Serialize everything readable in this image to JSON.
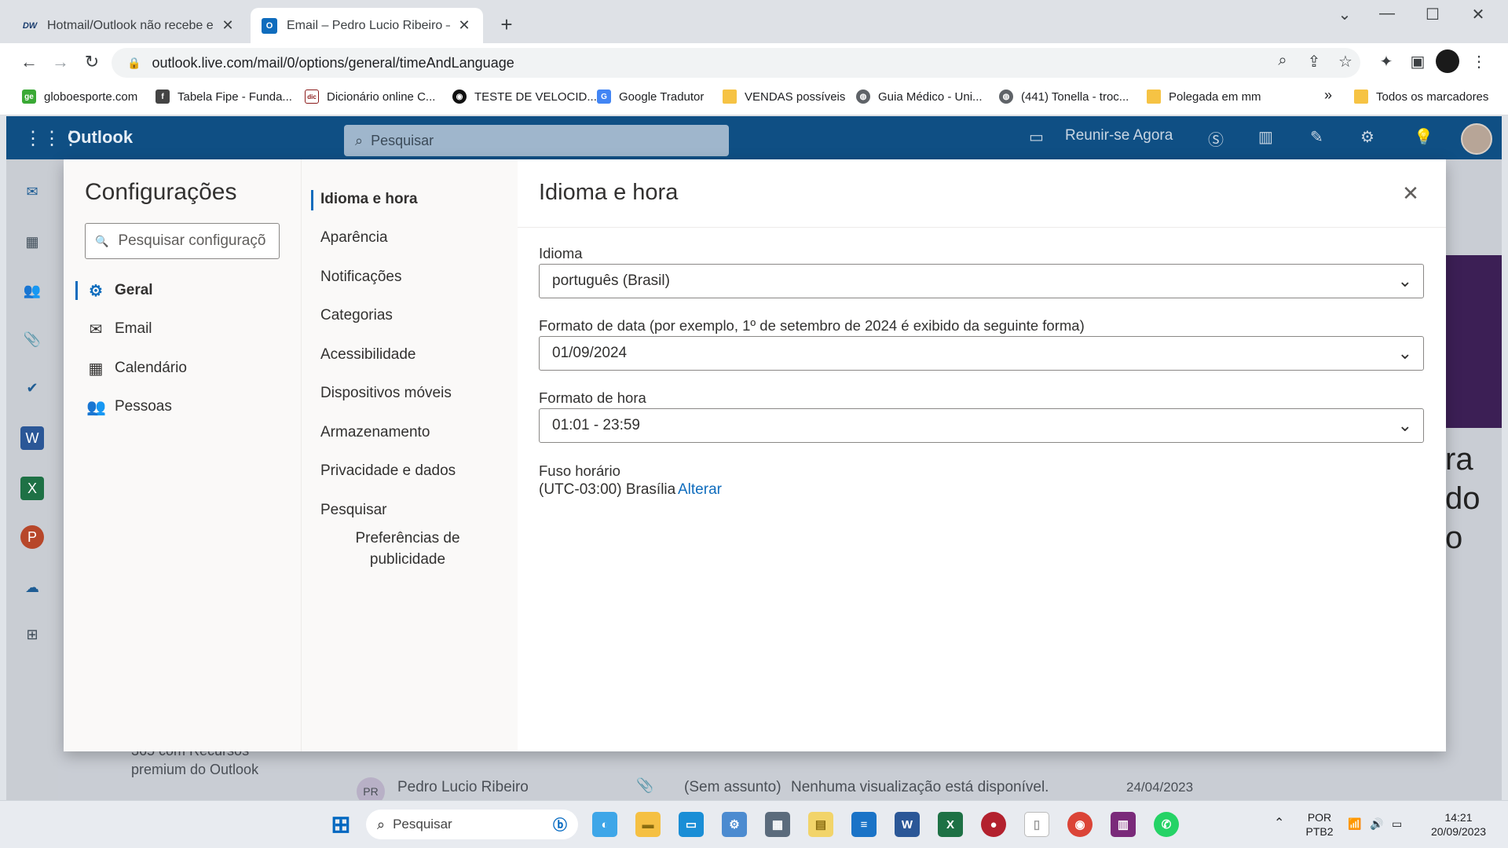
{
  "browser": {
    "tabs": [
      {
        "title": "Hotmail/Outlook não recebe e-m",
        "favicon": "DW",
        "active": false
      },
      {
        "title": "Email – Pedro Lucio Ribeiro – Ou",
        "favicon": "outlook",
        "active": true
      }
    ],
    "new_tab": "+",
    "url": "outlook.live.com/mail/0/options/general/timeAndLanguage",
    "bookmarks": [
      {
        "label": "globoesporte.com",
        "icon": "ge",
        "color": "#3aa935"
      },
      {
        "label": "Tabela Fipe - Funda...",
        "icon": "fipe",
        "color": "#444444"
      },
      {
        "label": "Dicionário online C...",
        "icon": "dic",
        "color": "#8b1a1a"
      },
      {
        "label": "TESTE DE VELOCID...",
        "icon": "speed",
        "color": "#111111"
      },
      {
        "label": "Google Tradutor",
        "icon": "translate",
        "color": "#4285f4"
      },
      {
        "label": "VENDAS possíveis",
        "icon": "folder",
        "color": "#f6c344"
      },
      {
        "label": "Guia Médico - Uni...",
        "icon": "globe",
        "color": "#5f6368"
      },
      {
        "label": "(441) Tonella - troc...",
        "icon": "globe",
        "color": "#5f6368"
      },
      {
        "label": "Polegada em mm",
        "icon": "folder",
        "color": "#f6c344"
      }
    ],
    "bookmarks_more": "»",
    "all_bookmarks": "Todos os marcadores"
  },
  "outlook": {
    "app_name": "Outlook",
    "search_placeholder": "Pesquisar",
    "meet_now": "Reunir-se Agora",
    "background_promo_line1": "365 com Recursos",
    "background_promo_line2": "premium do Outlook",
    "background_message": {
      "initials": "PR",
      "sender": "Pedro Lucio Ribeiro",
      "subject": "(Sem assunto)",
      "preview": "Nenhuma visualização está disponível.",
      "date": "24/04/2023"
    },
    "promo_big_text": [
      "ra",
      "do",
      "o"
    ]
  },
  "settings": {
    "title": "Configurações",
    "search_placeholder": "Pesquisar configuraçõ",
    "categories": [
      {
        "label": "Geral",
        "icon": "gear-icon",
        "selected": true
      },
      {
        "label": "Email",
        "icon": "mail-icon",
        "selected": false
      },
      {
        "label": "Calendário",
        "icon": "calendar-icon",
        "selected": false
      },
      {
        "label": "Pessoas",
        "icon": "people-icon",
        "selected": false
      }
    ],
    "subcategories": [
      {
        "label": "Idioma e hora",
        "selected": true
      },
      {
        "label": "Aparência",
        "selected": false
      },
      {
        "label": "Notificações",
        "selected": false
      },
      {
        "label": "Categorias",
        "selected": false
      },
      {
        "label": "Acessibilidade",
        "selected": false
      },
      {
        "label": "Dispositivos móveis",
        "selected": false
      },
      {
        "label": "Armazenamento",
        "selected": false
      },
      {
        "label": "Privacidade e dados",
        "selected": false
      },
      {
        "label": "Pesquisar",
        "selected": false
      },
      {
        "label": "Preferências de publicidade",
        "selected": false
      }
    ],
    "content": {
      "title": "Idioma e hora",
      "language_label": "Idioma",
      "language_value": "português (Brasil)",
      "date_format_label": "Formato de data (por exemplo, 1º de setembro de 2024 é exibido da seguinte forma)",
      "date_format_value": "01/09/2024",
      "time_format_label": "Formato de hora",
      "time_format_value": "01:01 - 23:59",
      "timezone_label": "Fuso horário",
      "timezone_value": "(UTC-03:00) Brasília",
      "timezone_change": "Alterar"
    }
  },
  "taskbar": {
    "search_placeholder": "Pesquisar",
    "language": "POR",
    "keyboard": "PTB2",
    "time": "14:21",
    "date": "20/09/2023"
  }
}
